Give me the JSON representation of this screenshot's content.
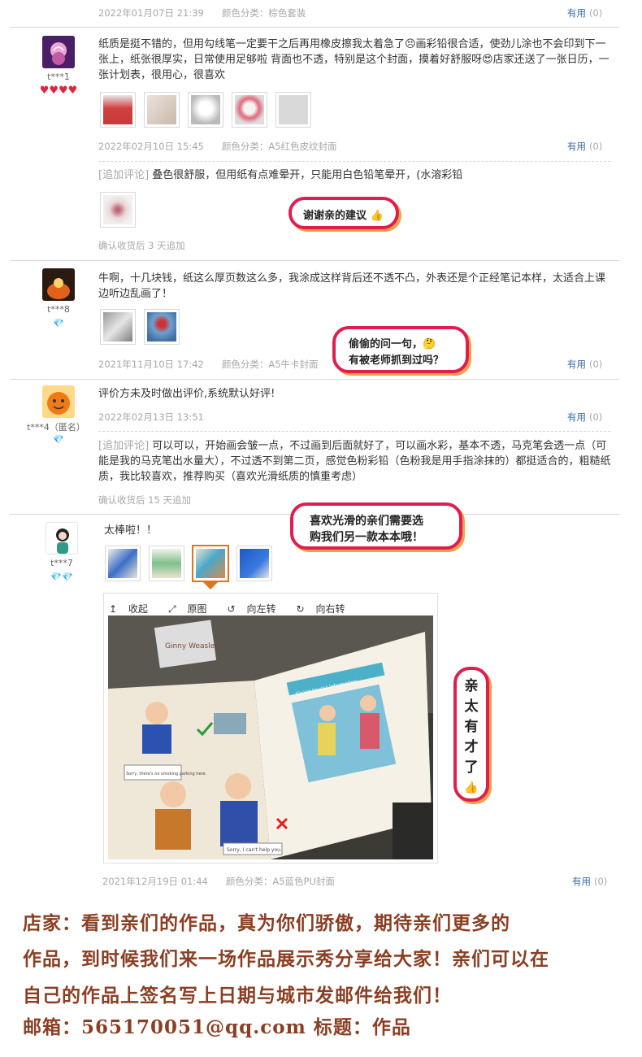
{
  "top_row": {
    "date": "2022年01月07日 21:39",
    "spec": "颜色分类：棕色套装",
    "useful": "有用",
    "count": "(0)"
  },
  "reviews": [
    {
      "user": "t***1",
      "level": "♥♥♥♥",
      "text": "纸质是挺不错的，但用勾线笔一定要干之后再用橡皮擦我太着急了😣画彩铅很合适，使劲儿涂也不会印到下一张上，纸张很厚实，日常使用足够啦 背面也不透，特别是这个封面，摸着好舒服呀😍店家还送了一张日历，一张计划表，很用心，很喜欢",
      "date": "2022年02月10日 15:45",
      "spec": "颜色分类：A5红色皮纹封面",
      "useful": "有用",
      "count": "(0)",
      "append_label": "[追加评论]",
      "append_text": "叠色很舒服，但用纸有点难晕开，只能用白色铅笔晕开，(水溶彩铅",
      "confirm": "确认收货后 3 天追加",
      "bubble": "谢谢亲的建议 👍"
    },
    {
      "user": "t***8",
      "level": "💎",
      "text": "牛啊，十几块钱，纸这么厚页数这么多，我涂成这样背后还不透不凸，外表还是个正经笔记本样，太适合上课边听边乱画了！",
      "date": "2021年11月10日 17:42",
      "spec": "颜色分类：A5牛卡封面",
      "useful": "有用",
      "count": "(0)",
      "bubble_line1": "偷偷的问一句，🤔",
      "bubble_line2": "有被老师抓到过吗？"
    },
    {
      "user": "t***4（匿名）",
      "level": "💎",
      "text": "评价方未及时做出评价,系统默认好评!",
      "date": "2022年02月13日 13:51",
      "useful": "有用",
      "count": "(0)",
      "append_label": "[追加评论]",
      "append_text": "可以可以，开始画会皱一点，不过画到后面就好了，可以画水彩，基本不透，马克笔会透一点（可能是我的马克笔出水量大），不过透不到第二页，感觉色粉彩铅（色粉我是用手指涂抹的）都挺适合的，粗糙纸质，我比较喜欢，推荐购买（喜欢光滑纸质的慎重考虑）",
      "confirm": "确认收货后 15 天追加",
      "bubble_line1": "喜欢光滑的亲们需要选",
      "bubble_line2": "购我们另一款本本哦！"
    },
    {
      "user": "t***7",
      "level": "💎💎",
      "text": "太棒啦！！",
      "toolbar": {
        "collapse": "收起",
        "original": "原图",
        "rotate_left": "向左转",
        "rotate_right": "向右转"
      },
      "photo_text": {
        "sign_top": "Giving tourist information",
        "sign_left": "Ginny Weasley",
        "note1": "Sorry, there's no smoking parking here.",
        "note2": "Sorry, I can't help you."
      },
      "date": "2021年12月19日 01:44",
      "spec": "颜色分类：A5蓝色PU封面",
      "useful": "有用",
      "count": "(0)",
      "bubble_chars": [
        "亲",
        "太",
        "有",
        "才",
        "了",
        "👍"
      ]
    }
  ],
  "shop_note": {
    "line1": "店家：看到亲们的作品，真为你们骄傲，期待亲们更多的",
    "line2": "作品，到时候我们来一场作品展示秀分享给大家！亲们可以在",
    "line3": "自己的作品上签名写上日期与城市发邮件给我们！",
    "line4": "邮箱：565170051@qq.com  标题：作品"
  },
  "colors": {
    "bubble_border": "#e01d4f",
    "bubble_shadow": "#f2a04a",
    "link": "#3a6ea5",
    "shop_text": "#8a3f24"
  }
}
